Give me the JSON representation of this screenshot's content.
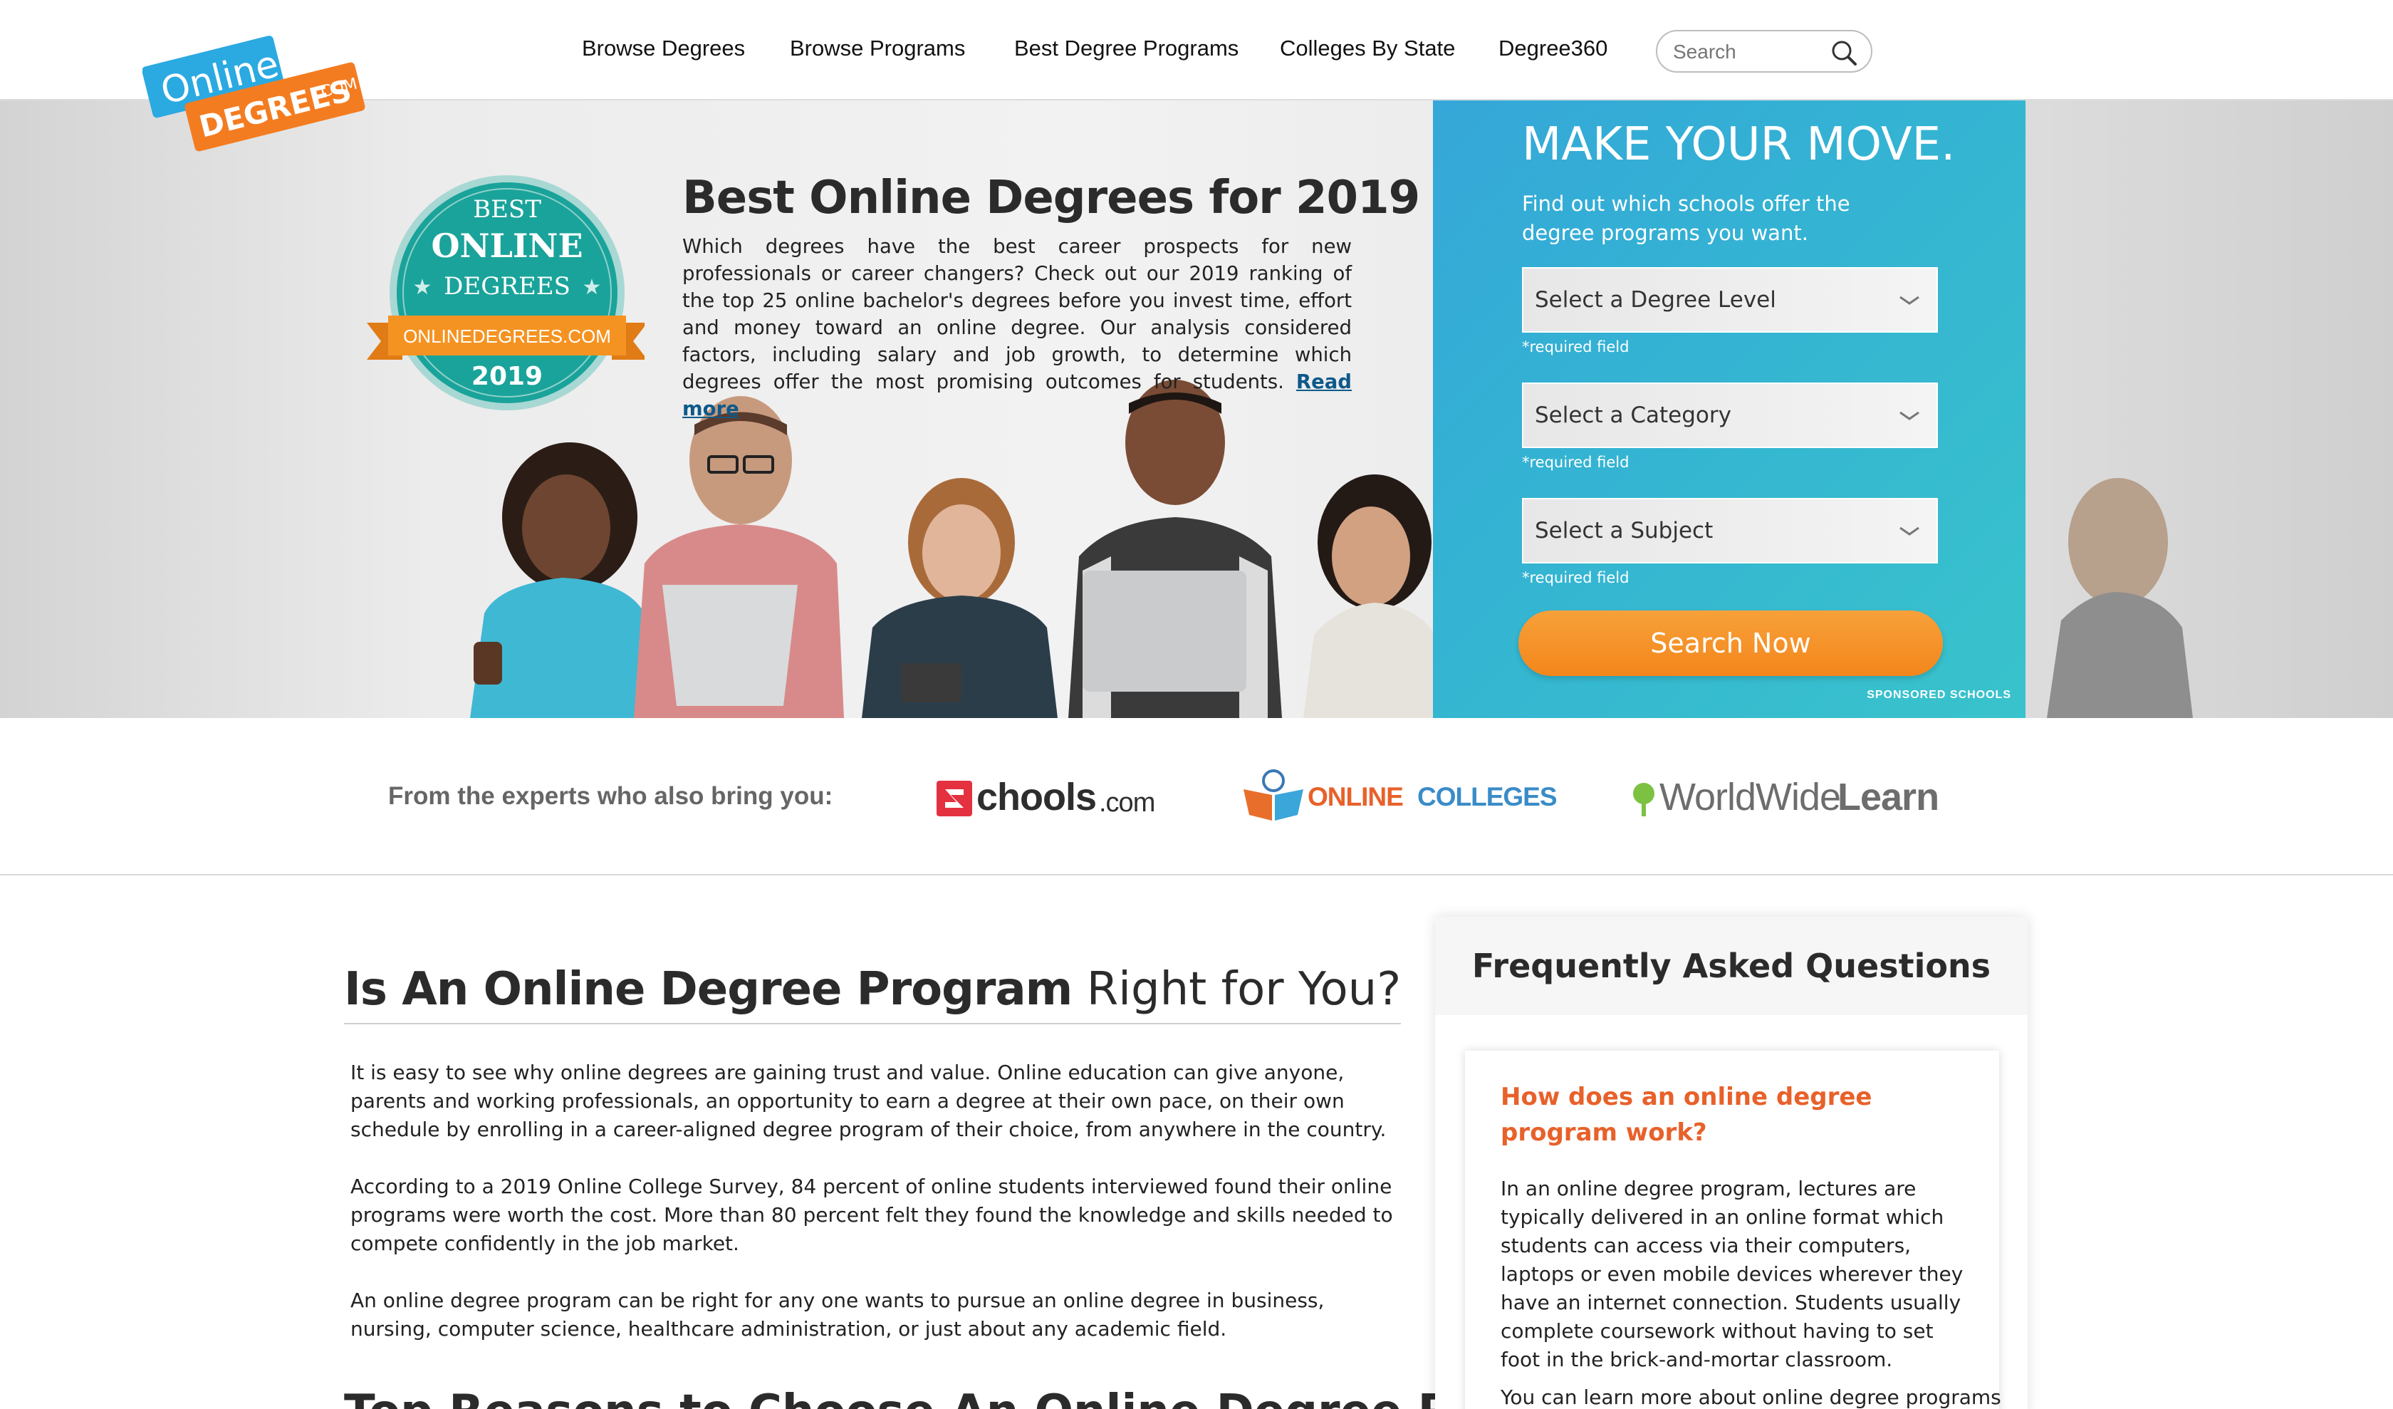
{
  "logo": {
    "line1": "Online",
    "line2": "DEGREES",
    "suffix": ".COM"
  },
  "nav": {
    "items": [
      "Browse Degrees",
      "Browse Programs",
      "Best Degree Programs",
      "Colleges By State",
      "Degree360"
    ],
    "search_placeholder": "Search"
  },
  "hero": {
    "badge": {
      "top": "BEST",
      "middle": "ONLINE",
      "bottom": "DEGREES",
      "ribbon": "ONLINEDEGREES.COM",
      "year": "2019"
    },
    "title": "Best Online Degrees for 2019",
    "body": "Which degrees have the best career prospects for new professionals or career changers? Check out our 2019 ranking of the top 25 online bachelor's degrees before you invest time, effort and money toward an online degree. Our analysis considered factors, including salary and job growth, to determine which degrees offer the most promising outcomes for students.",
    "read_more": "Read more"
  },
  "panel": {
    "title": "MAKE YOUR MOVE.",
    "subtitle": "Find out which schools offer the degree programs you want.",
    "selects": [
      {
        "label": "Select a Degree Level",
        "required": "*required field"
      },
      {
        "label": "Select a Category",
        "required": "*required field"
      },
      {
        "label": "Select a Subject",
        "required": "*required field"
      }
    ],
    "button": "Search Now",
    "sponsored": "SPONSORED SCHOOLS"
  },
  "partners": {
    "label": "From the experts who also bring you:",
    "logos": [
      {
        "name": "chools",
        "suffix": ".com"
      },
      {
        "name_a": "ONLINE",
        "name_b": "COLLEGES"
      },
      {
        "name_a": "WorldWide",
        "name_b": "Learn"
      }
    ]
  },
  "main": {
    "heading_bold": "Is An Online Degree Program",
    "heading_light": " Right for You?",
    "paragraphs": [
      "It is easy to see why online degrees are gaining trust and value. Online education can give anyone, parents and working professionals, an opportunity to earn a degree at their own pace, on their own schedule by enrolling in a career-aligned degree program of their choice, from anywhere in the country.",
      "According to a 2019 Online College Survey, 84 percent of online students interviewed found their online programs were worth the cost. More than 80 percent felt they found the knowledge and skills needed to compete confidently in the job market.",
      "An online degree program can be right for any one wants to pursue an online degree in business, nursing, computer science, healthcare administration, or just about any academic field."
    ],
    "next_heading": "Top Reasons to Choose An Online Degree Program"
  },
  "faq": {
    "title": "Frequently Asked Questions",
    "question": "How does an online degree program work?",
    "answer": "In an online degree program, lectures are typically delivered in an online format which students can access via their computers, laptops or even mobile devices wherever they have an internet connection. Students usually complete coursework without having to set foot in the brick-and-mortar classroom.",
    "more": "You can learn more about online degree programs"
  },
  "colors": {
    "accent_orange": "#f3861b",
    "panel_blue": "#35a7d9",
    "faq_orange": "#e8612a",
    "link_blue": "#0d5a8a"
  }
}
